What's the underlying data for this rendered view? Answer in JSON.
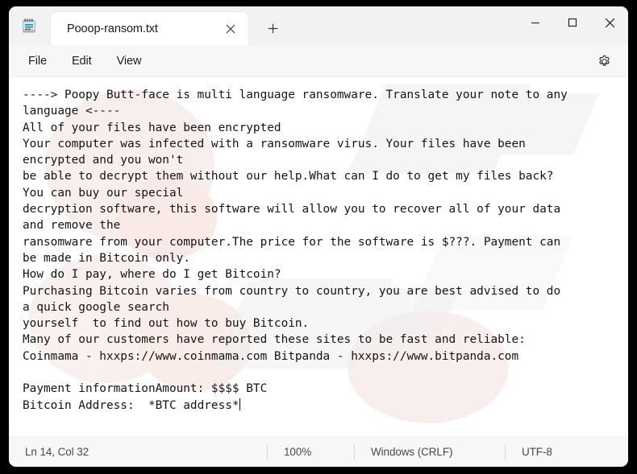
{
  "window": {
    "app_icon": "notepad-icon",
    "caption_buttons": [
      {
        "name": "minimize",
        "glyph": "—"
      },
      {
        "name": "maximize",
        "glyph": "□"
      },
      {
        "name": "close",
        "glyph": "✕"
      }
    ]
  },
  "tabs": [
    {
      "title": "Pooop-ransom.txt",
      "close_glyph": "✕"
    }
  ],
  "newtab": {
    "glyph": "+",
    "label": "New tab"
  },
  "menu": {
    "items": [
      {
        "label": "File"
      },
      {
        "label": "Edit"
      },
      {
        "label": "View"
      }
    ],
    "settings_icon": "gear-icon"
  },
  "document": {
    "lines": [
      "----> Poopy Butt-face is multi language ransomware. Translate your note to any",
      "language <----",
      "All of your files have been encrypted",
      "Your computer was infected with a ransomware virus. Your files have been",
      "encrypted and you won't",
      "be able to decrypt them without our help.What can I do to get my files back?",
      "You can buy our special",
      "decryption software, this software will allow you to recover all of your data",
      "and remove the",
      "ransomware from your computer.The price for the software is $???. Payment can",
      "be made in Bitcoin only.",
      "How do I pay, where do I get Bitcoin?",
      "Purchasing Bitcoin varies from country to country, you are best advised to do",
      "a quick google search",
      "yourself  to find out how to buy Bitcoin.",
      "Many of our customers have reported these sites to be fast and reliable:",
      "Coinmama - hxxps://www.coinmama.com Bitpanda - hxxps://www.bitpanda.com",
      "",
      "Payment informationAmount: $$$$ BTC",
      "Bitcoin Address:  *BTC address*"
    ]
  },
  "statusbar": {
    "position": "Ln 14, Col 32",
    "zoom": "100%",
    "line_ending": "Windows (CRLF)",
    "encoding": "UTF-8"
  },
  "colors": {
    "window_bg": "#f7f7f7",
    "titlebar_bg": "#f2f2f2",
    "tab_active_bg": "#ffffff",
    "editor_bg": "#ffffff",
    "text": "#141414",
    "status_text": "#4a4a4a",
    "desktop": "#000000"
  }
}
